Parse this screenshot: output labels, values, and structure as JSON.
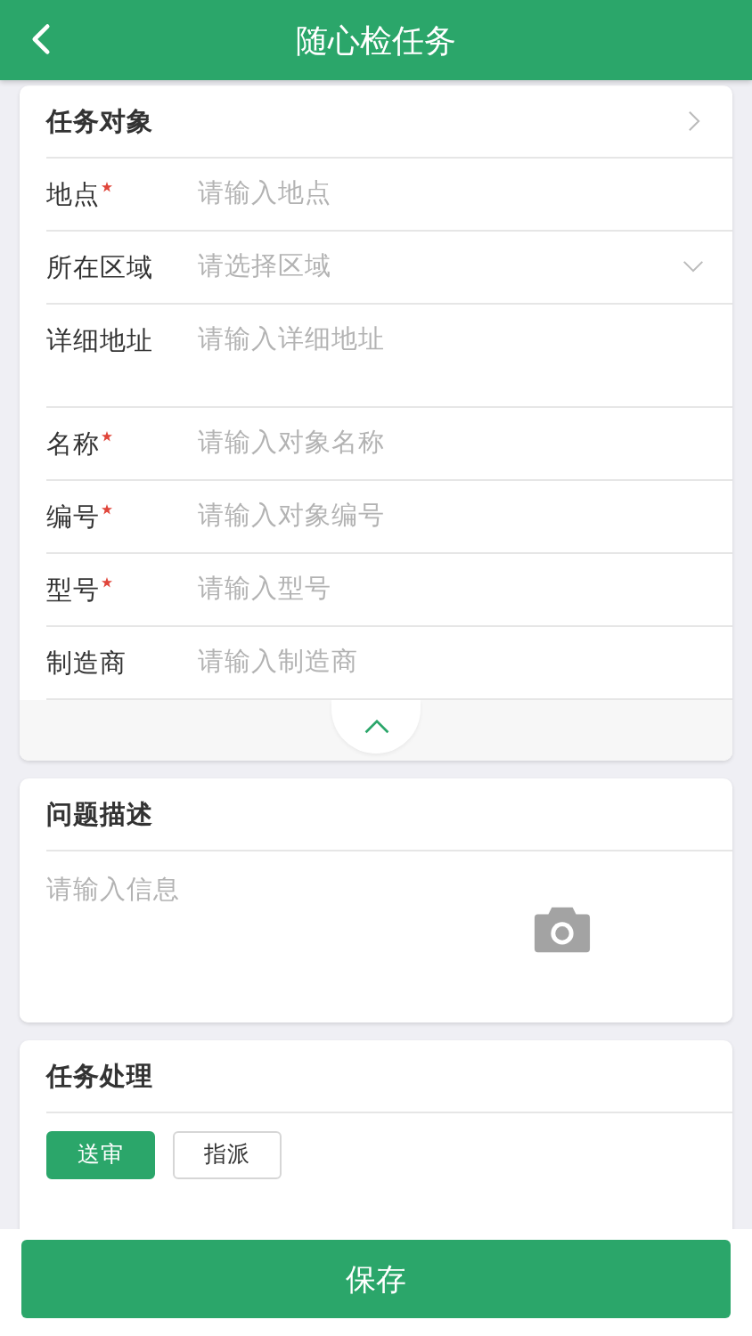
{
  "header": {
    "title": "随心检任务"
  },
  "object_section": {
    "title": "任务对象",
    "expanded": true,
    "fields": [
      {
        "label": "地点",
        "required": true,
        "kind": "input",
        "placeholder": "请输入地点"
      },
      {
        "label": "所在区域",
        "required": false,
        "kind": "select",
        "placeholder": "请选择区域"
      },
      {
        "label": "详细地址",
        "required": false,
        "kind": "textarea",
        "placeholder": "请输入详细地址"
      },
      {
        "label": "名称",
        "required": true,
        "kind": "input",
        "placeholder": "请输入对象名称"
      },
      {
        "label": "编号",
        "required": true,
        "kind": "input",
        "placeholder": "请输入对象编号"
      },
      {
        "label": "型号",
        "required": true,
        "kind": "input",
        "placeholder": "请输入型号"
      },
      {
        "label": "制造商",
        "required": false,
        "kind": "input",
        "placeholder": "请输入制造商"
      }
    ]
  },
  "problem_section": {
    "title": "问题描述",
    "placeholder": "请输入信息"
  },
  "handling_section": {
    "title": "任务处理",
    "actions": [
      {
        "label": "送审",
        "selected": true
      },
      {
        "label": "指派",
        "selected": false
      }
    ]
  },
  "save_button": "保存"
}
